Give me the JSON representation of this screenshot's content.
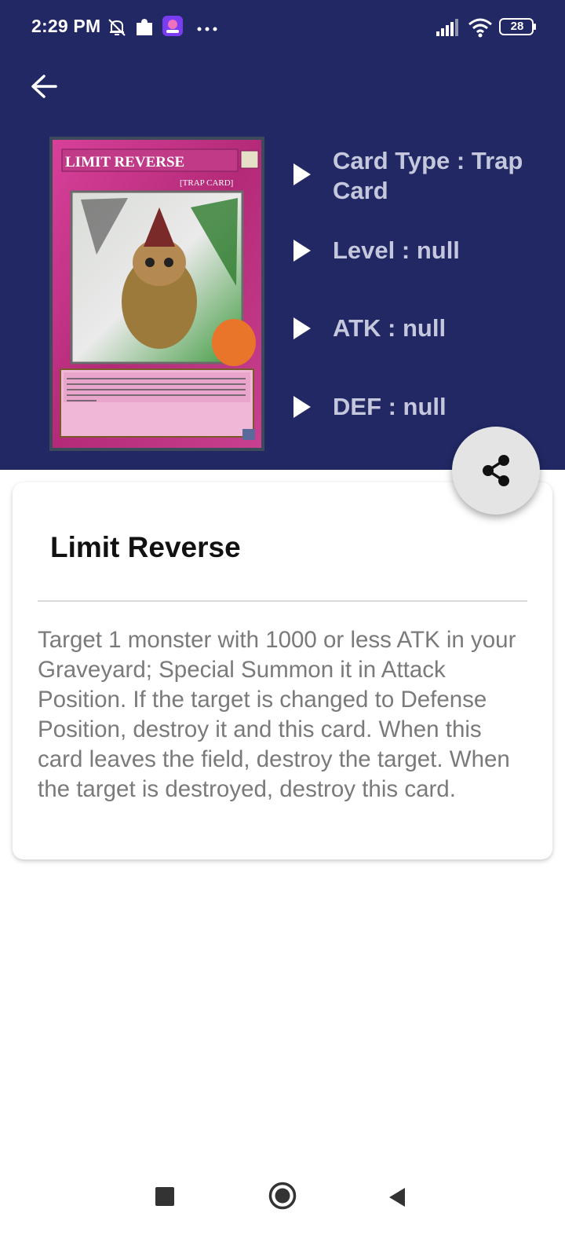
{
  "status_bar": {
    "time": "2:29 PM",
    "battery": "28",
    "icons": [
      "mute-bell-icon",
      "puzzle-icon",
      "app-notification-icon",
      "more-dots-icon",
      "signal-icon",
      "wifi-icon",
      "battery-icon"
    ]
  },
  "card_image": {
    "name": "Limit Reverse",
    "type_line": "[Trap Card]"
  },
  "info": {
    "card_type": "Card Type : Trap Card",
    "level": "Level : null",
    "atk": "ATK : null",
    "def": "DEF : null"
  },
  "card": {
    "title": "Limit Reverse",
    "description": "Target 1 monster with 1000 or less ATK in your Graveyard; Special Summon it in Attack Position. If the target is changed to Defense Position, destroy it and this card. When this card leaves the field, destroy the target. When the target is destroyed, destroy this card."
  },
  "colors": {
    "header_bg": "#212864",
    "info_text": "#c5c7dc",
    "fab_bg": "#e4e4e4",
    "card_frame": "#c0307e"
  }
}
